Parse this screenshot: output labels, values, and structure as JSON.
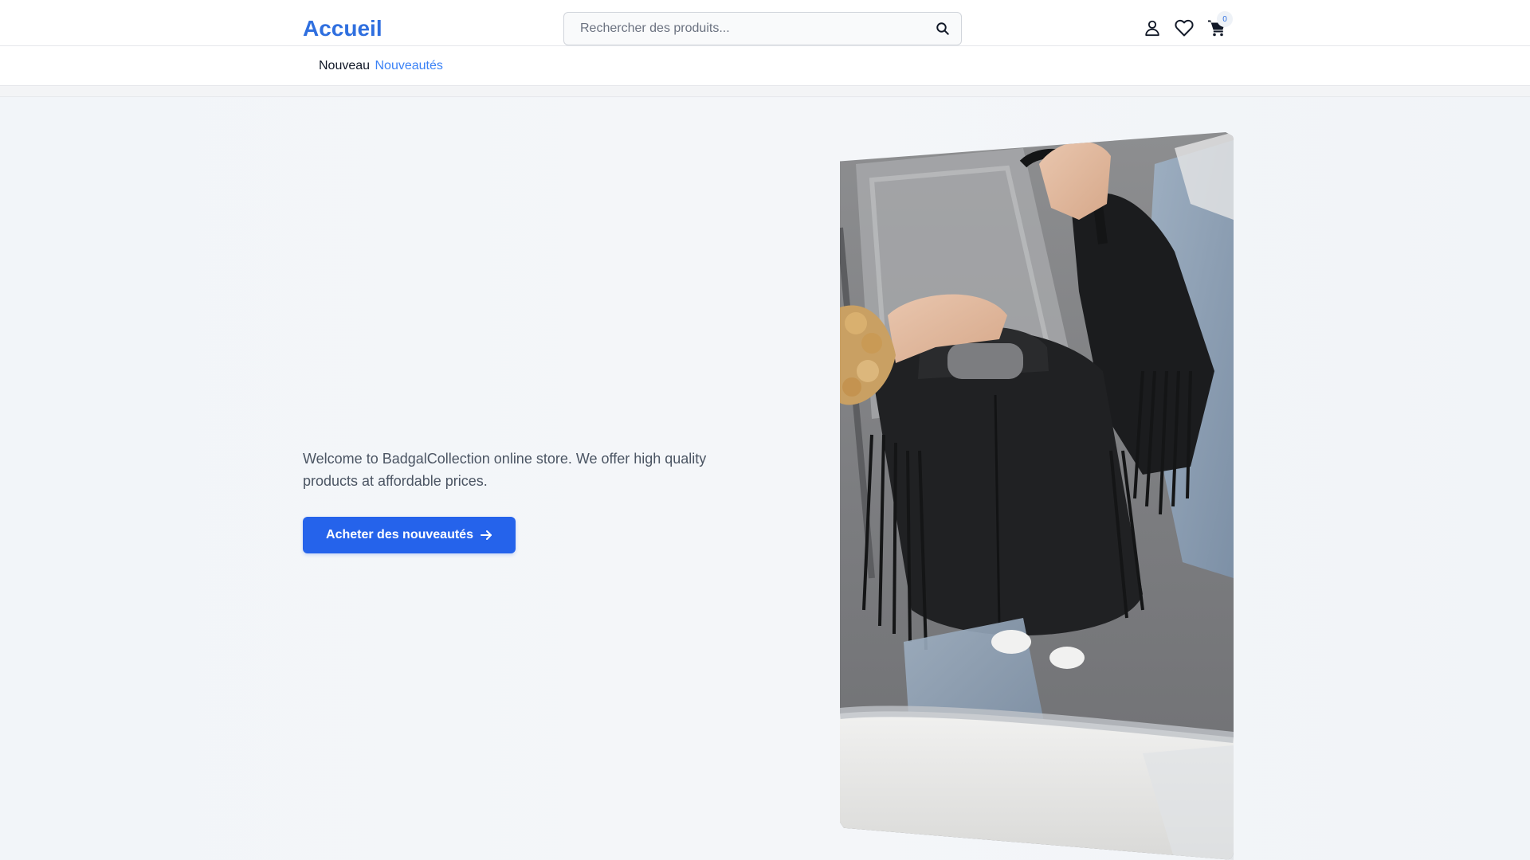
{
  "header": {
    "logo": "Accueil",
    "search_placeholder": "Rechercher des produits...",
    "cart_count": "0"
  },
  "subnav": {
    "label": "Nouveau",
    "link": "Nouveautés"
  },
  "hero": {
    "description": "Welcome to BadgalCollection online store. We offer high quality products at affordable prices.",
    "cta_label": "Acheter des nouveautés"
  },
  "colors": {
    "brand": "#2f6fdf",
    "cta": "#2563eb",
    "link": "#3b82f6"
  },
  "icons": [
    "search-icon",
    "user-icon",
    "heart-icon",
    "cart-icon",
    "arrow-right-icon"
  ]
}
